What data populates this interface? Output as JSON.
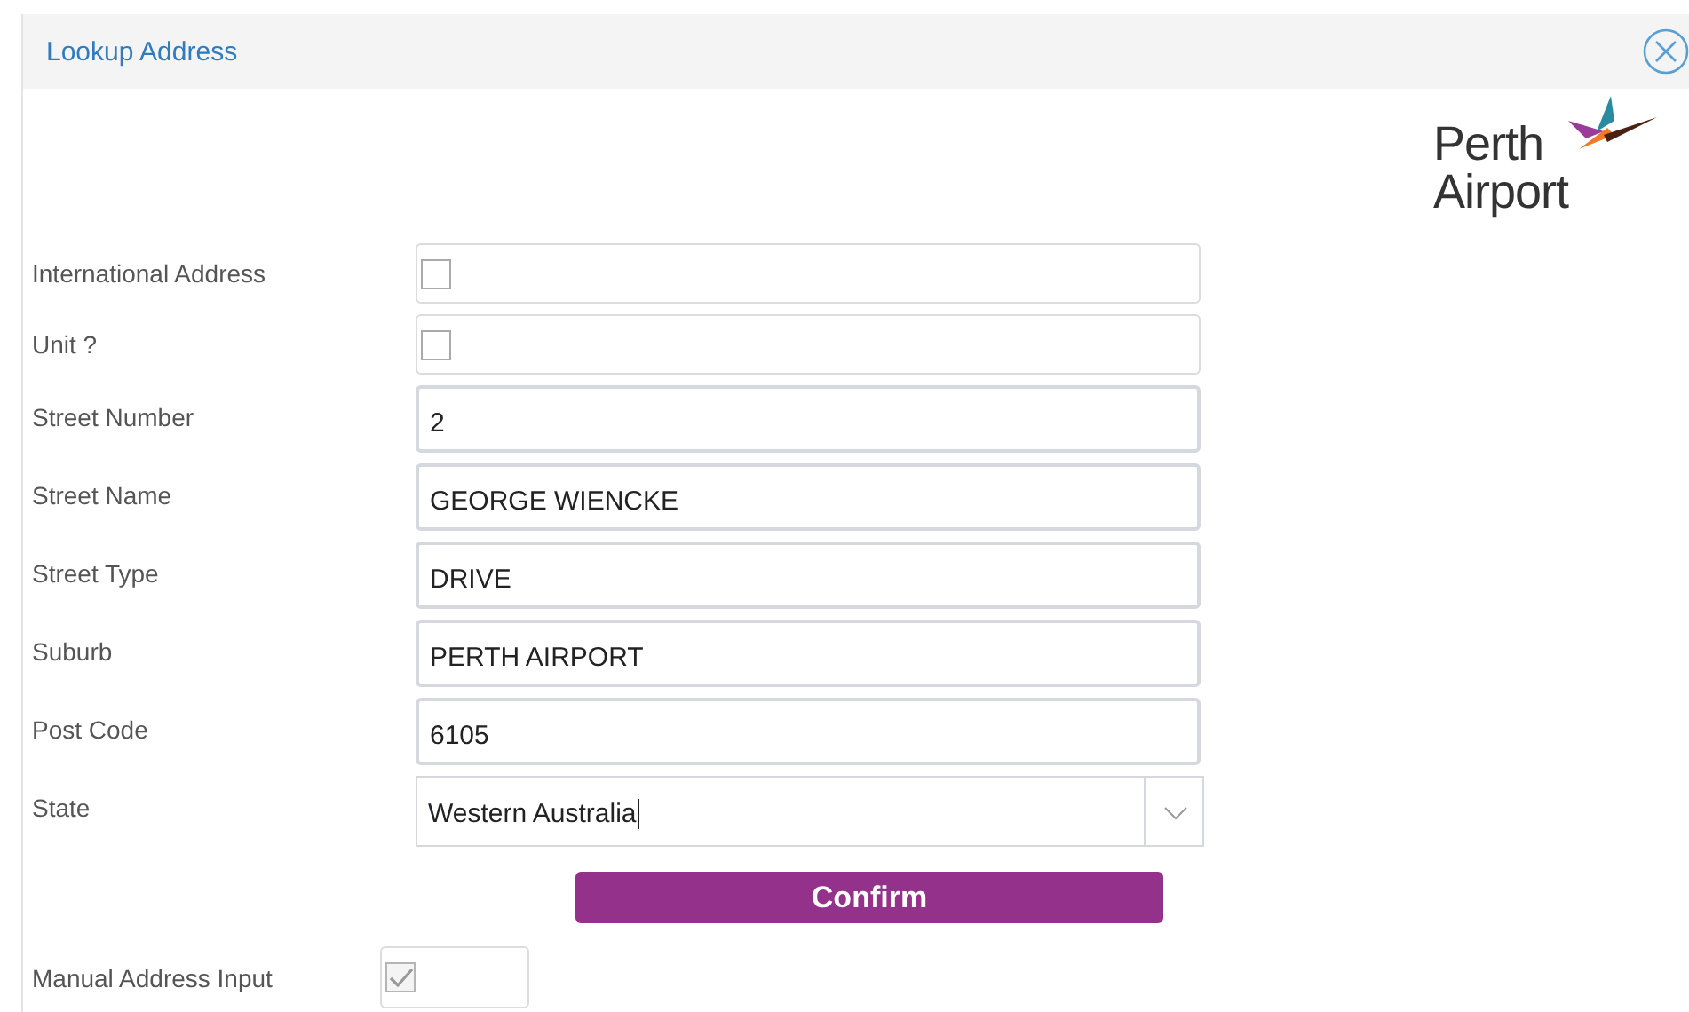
{
  "dialog": {
    "title": "Lookup Address",
    "logo": {
      "line_1": "Perth",
      "line_2": "Airport"
    }
  },
  "fields": [
    {
      "label": "International Address",
      "kind": "checkbox",
      "checked": false
    },
    {
      "label": "Unit ?",
      "kind": "checkbox",
      "checked": false
    },
    {
      "label": "Street Number",
      "kind": "text",
      "value": "2"
    },
    {
      "label": "Street Name",
      "kind": "text",
      "value": "GEORGE WIENCKE"
    },
    {
      "label": "Street Type",
      "kind": "text",
      "value": "DRIVE"
    },
    {
      "label": "Suburb",
      "kind": "text",
      "value": "PERTH AIRPORT"
    },
    {
      "label": "Post Code",
      "kind": "text",
      "value": "6105"
    },
    {
      "label": "State",
      "kind": "select",
      "value": "Western Australia"
    }
  ],
  "confirm_button": "Confirm",
  "manual_input": {
    "label": "Manual Address Input",
    "checked": true,
    "disabled": true
  }
}
